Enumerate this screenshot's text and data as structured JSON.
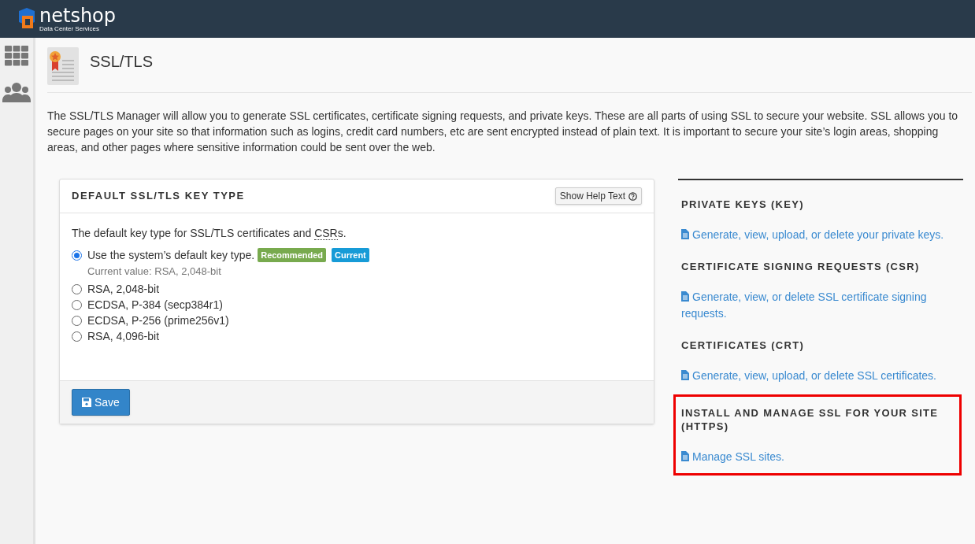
{
  "header": {
    "logo": {
      "name": "netshop",
      "tagline": "Data Center Services"
    }
  },
  "sidebar": {
    "items": [
      {
        "kind": "apps"
      },
      {
        "kind": "people"
      }
    ]
  },
  "page": {
    "title": "SSL/TLS",
    "description": "The SSL/TLS Manager will allow you to generate SSL certificates, certificate signing requests, and private keys. These are all parts of using SSL to secure your website. SSL allows you to secure pages on your site so that information such as logins, credit card numbers, etc are sent encrypted instead of plain text. It is important to secure your site’s login areas, shopping areas, and other pages where sensitive information could be sent over the web."
  },
  "key_type_card": {
    "title": "DEFAULT SSL/TLS KEY TYPE",
    "help_button": "Show Help Text",
    "intro": {
      "before": "The default key type for SSL/TLS certificates and ",
      "abbr": "CSR",
      "after": "s."
    },
    "options": [
      {
        "label": "Use the system’s default key type.",
        "selected": true,
        "badges": [
          {
            "text": "Recommended",
            "color": "#78aa4e"
          },
          {
            "text": "Current",
            "color": "#179bd7"
          }
        ],
        "note": "Current value: RSA, 2,048-bit"
      },
      {
        "label": "RSA, 2,048-bit",
        "selected": false
      },
      {
        "label": "ECDSA, P-384 (secp384r1)",
        "selected": false
      },
      {
        "label": "ECDSA, P-256 (prime256v1)",
        "selected": false
      },
      {
        "label": "RSA, 4,096-bit",
        "selected": false
      }
    ],
    "save_button": "Save"
  },
  "sections": [
    {
      "heading": "PRIVATE KEYS (KEY)",
      "link": "Generate, view, upload, or delete your private keys.",
      "highlighted": false
    },
    {
      "heading": "CERTIFICATE SIGNING REQUESTS (CSR)",
      "link": "Generate, view, or delete SSL certificate signing requests.",
      "highlighted": false
    },
    {
      "heading": "CERTIFICATES (CRT)",
      "link": "Generate, view, upload, or delete SSL certificates.",
      "highlighted": false
    },
    {
      "heading": "INSTALL AND MANAGE SSL FOR YOUR SITE (HTTPS)",
      "link": "Manage SSL sites.",
      "highlighted": true
    }
  ]
}
